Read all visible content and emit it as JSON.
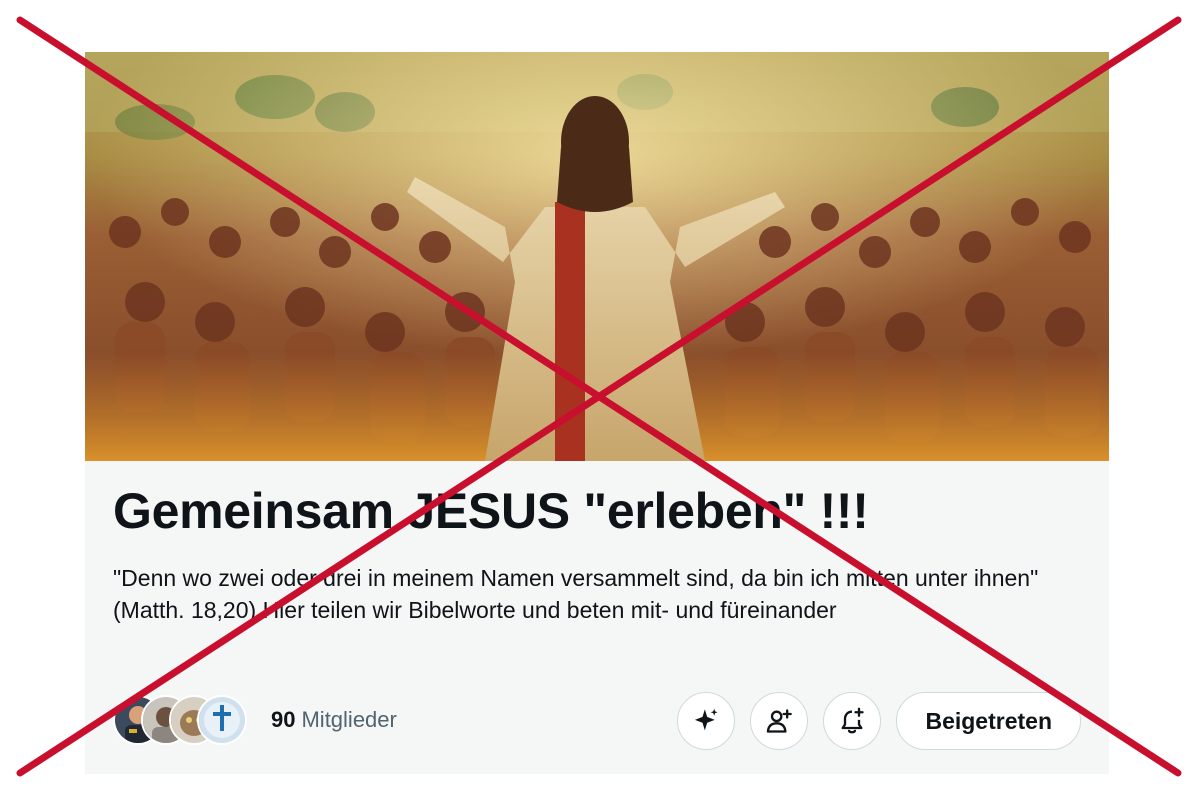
{
  "community": {
    "title": "Gemeinsam JESUS \"erleben\" !!!",
    "description": "\"Denn wo zwei oder drei in meinem Namen versammelt sind, da bin ich mitten unter ihnen\" (Matth. 18,20) Hier teilen wir Bibelworte und beten mit- und füreinander",
    "member_count": "90",
    "member_label": "Mitglieder"
  },
  "actions": {
    "sparkle_icon": "sparkle-icon",
    "invite_icon": "person-add-icon",
    "notify_icon": "bell-plus-icon",
    "joined_label": "Beigetreten"
  },
  "overlay": {
    "cross_color": "#c8102e"
  },
  "colors": {
    "text_primary": "#0f1419",
    "text_secondary": "#536471",
    "card_bg": "#f5f6f6",
    "button_border": "#cfd9de"
  }
}
